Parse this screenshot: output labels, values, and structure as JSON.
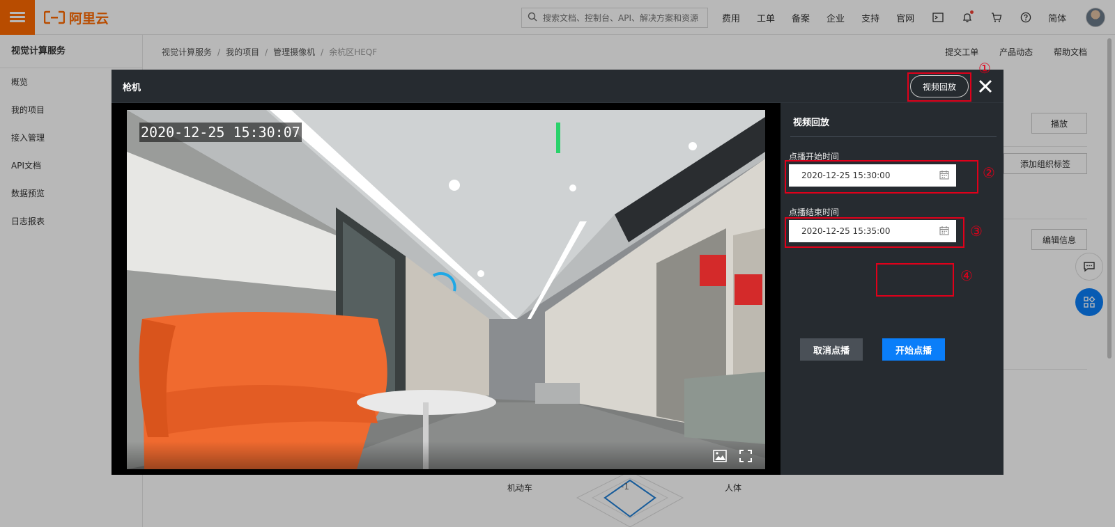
{
  "topbar": {
    "logo_text": "阿里云",
    "search_placeholder": "搜索文档、控制台、API、解决方案和资源",
    "nav": [
      "费用",
      "工单",
      "备案",
      "企业",
      "支持",
      "官网"
    ],
    "lang": "简体",
    "icons": [
      "terminal-icon",
      "bell-icon",
      "cart-icon",
      "help-icon"
    ]
  },
  "sidebar": {
    "title": "视觉计算服务",
    "items": [
      "概览",
      "我的项目",
      "接入管理",
      "API文档",
      "数据预览",
      "日志报表"
    ]
  },
  "breadcrumb": {
    "items": [
      "视觉计算服务",
      "我的项目",
      "管理摄像机",
      "余杭区HEQF"
    ]
  },
  "top_links": [
    "提交工单",
    "产品动态",
    "帮助文档"
  ],
  "page_buttons": {
    "play": "播放",
    "add_tag": "添加组织标签",
    "edit_info": "编辑信息"
  },
  "radar": {
    "center_value": "-1",
    "left_label": "机动车",
    "right_label": "人体"
  },
  "modal": {
    "title": "枪机",
    "playback_button": "视频回放",
    "timestamp": "2020-12-25 15:30:07",
    "panel": {
      "title": "视频回放",
      "start_label": "点播开始时间",
      "start_value": "2020-12-25 15:30:00",
      "end_label": "点播结束时间",
      "end_value": "2020-12-25 15:35:00",
      "cancel_button": "取消点播",
      "start_button": "开始点播"
    },
    "annotations": [
      "①",
      "②",
      "③",
      "④"
    ]
  },
  "colors": {
    "brand": "#ff6a00",
    "primary": "#0a7ef9",
    "annotation": "#e0001a"
  }
}
